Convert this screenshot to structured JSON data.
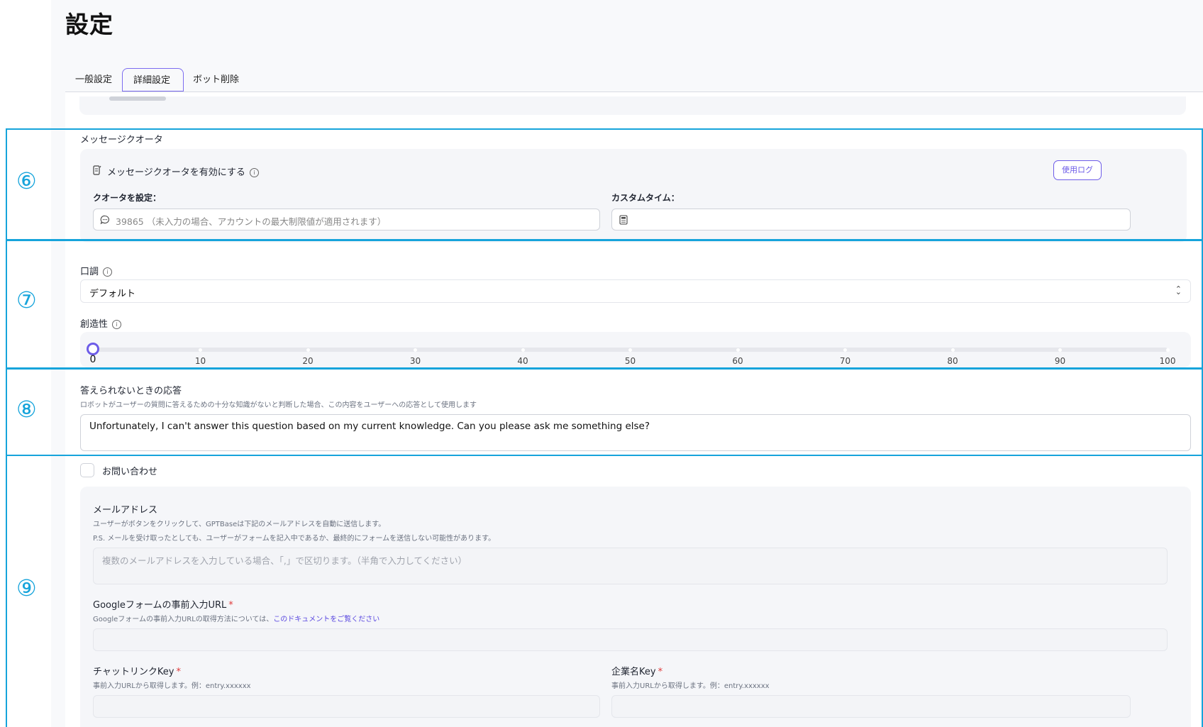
{
  "page": {
    "title": "設定"
  },
  "tabs": [
    {
      "label": "一般設定"
    },
    {
      "label": "詳細設定"
    },
    {
      "label": "ボット削除"
    }
  ],
  "quota": {
    "section_label": "メッセージクオータ",
    "enable_label": "メッセージクオータを有効にする",
    "usage_log_button": "使用ログ",
    "set_quota_label": "クオータを設定：",
    "quota_placeholder": "39865 （未入力の場合、アカウントの最大制限値が適用されます）",
    "custom_time_label": "カスタムタイム："
  },
  "tone": {
    "label": "口調",
    "selected": "デフォルト"
  },
  "creativity": {
    "label": "創造性",
    "value": 0,
    "ticks": [
      "0",
      "10",
      "20",
      "30",
      "40",
      "50",
      "60",
      "70",
      "80",
      "90",
      "100"
    ]
  },
  "fallback": {
    "label": "答えられないときの応答",
    "description": "ロボットがユーザーの質問に答えるための十分な知識がないと判断した場合、この内容をユーザーへの応答として使用します",
    "value": "Unfortunately, I can't answer this question based on my current knowledge. Can you please ask me something else?"
  },
  "contact": {
    "checkbox_label": "お問い合わせ",
    "email_label": "メールアドレス",
    "email_desc_1": "ユーザーがボタンをクリックして、GPTBaseは下記のメールアドレスを自動に送信します。",
    "email_desc_2": "P.S. メールを受け取ったとしても、ユーザーがフォームを記入中であるか、最終的にフォームを送信しない可能性があります。",
    "email_placeholder": "複数のメールアドレスを入力している場合、「,」で区切ります。（半角で入力してください）",
    "google_form_label": "Googleフォームの事前入力URL",
    "google_form_desc": "Googleフォームの事前入力URLの取得方法については、",
    "google_form_link": "このドキュメントをご覧ください",
    "chat_link_key_label": "チャットリンクKey",
    "chat_link_key_desc": "事前入力URLから取得します。例：entry.xxxxxx",
    "company_key_label": "企業名Key",
    "company_key_desc": "事前入力URLから取得します。例：entry.xxxxxx",
    "required_mark": "*"
  },
  "annotations": [
    "⑥",
    "⑦",
    "⑧",
    "⑨"
  ],
  "colors": {
    "accent": "#6d5ce8",
    "annotation": "#16a4db",
    "required": "#e03a3a"
  }
}
